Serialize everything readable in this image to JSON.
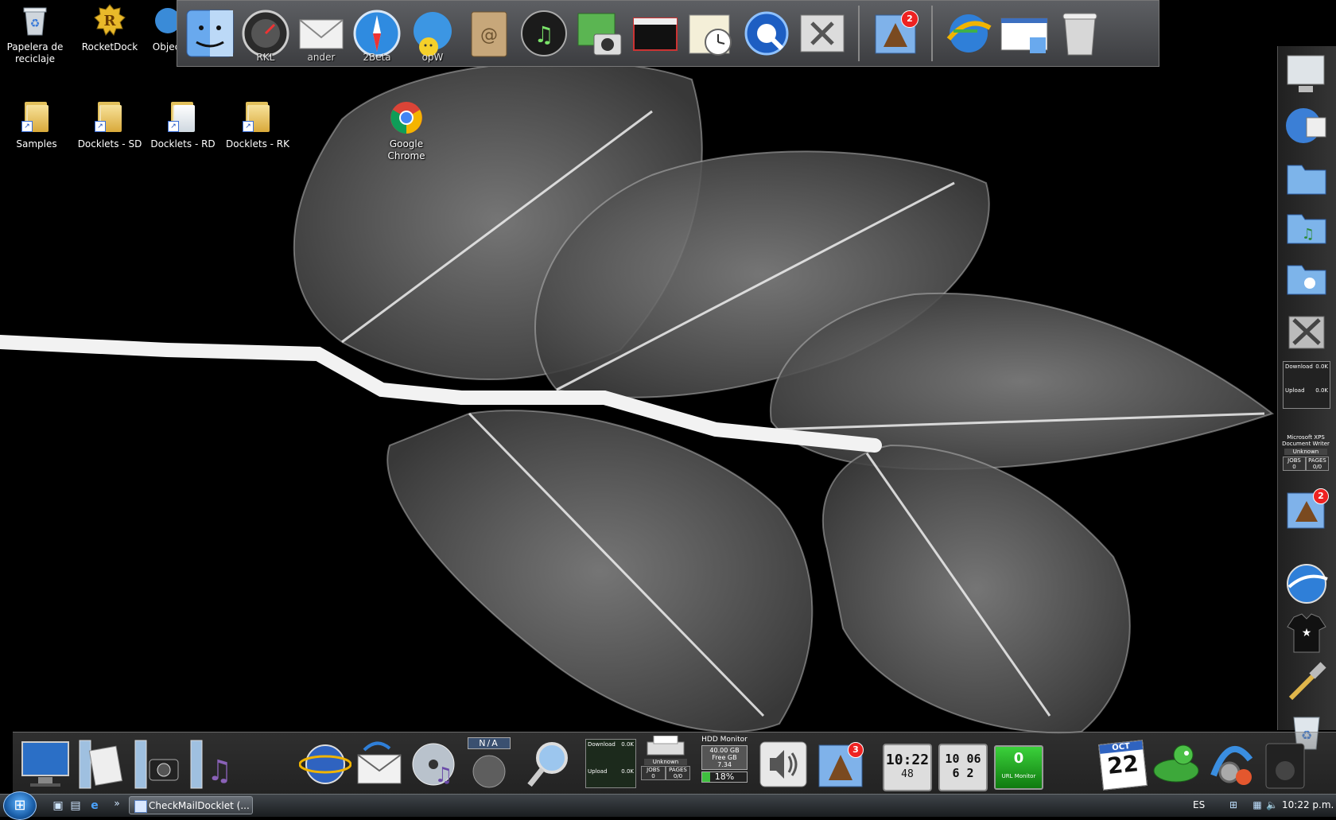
{
  "desktop": {
    "icons": [
      {
        "label": "Papelera de\nreciclaje"
      },
      {
        "label": "RocketDock"
      },
      {
        "label": "Objec"
      },
      {
        "label": "Samples"
      },
      {
        "label": "Docklets - SD"
      },
      {
        "label": "Docklets - RD"
      },
      {
        "label": "Docklets - RK"
      },
      {
        "label": "Google Chrome"
      }
    ]
  },
  "top_dock": {
    "items": [
      {
        "icon": "finder-icon",
        "label": ""
      },
      {
        "icon": "dashboard-icon",
        "label": "RKL"
      },
      {
        "icon": "mail-icon",
        "label": "ander"
      },
      {
        "icon": "safari-icon",
        "label": "2Beta"
      },
      {
        "icon": "messenger-icon",
        "label": "opW"
      },
      {
        "icon": "address-book-icon",
        "label": ""
      },
      {
        "icon": "itunes-icon",
        "label": ""
      },
      {
        "icon": "iphoto-icon",
        "label": ""
      },
      {
        "icon": "movie-icon",
        "label": ""
      },
      {
        "icon": "ical-icon",
        "label": ""
      },
      {
        "icon": "quicktime-icon",
        "label": ""
      },
      {
        "icon": "utilities-icon",
        "label": ""
      },
      {
        "icon": "mail-hawk-icon",
        "label": "",
        "badge": "2"
      },
      {
        "icon": "network-globe-icon",
        "label": ""
      },
      {
        "icon": "window-finder-icon",
        "label": ""
      },
      {
        "icon": "trash-icon",
        "label": ""
      }
    ]
  },
  "right_dock": {
    "download": "Download",
    "download_value": "0.0K",
    "upload": "Upload",
    "upload_value": "0.0K",
    "printer_name": "Microsoft XPS Document Writer",
    "printer_status": "Unknown",
    "jobs_label": "JOBS",
    "jobs_value": "0",
    "pages_label": "PAGES",
    "pages_value": "0/0",
    "mail_badge": "2"
  },
  "bottom_dock": {
    "na_label": "N/A",
    "download": "Download",
    "download_value": "0.0K",
    "upload": "Upload",
    "upload_value": "0.0K",
    "printer_status": "Unknown",
    "jobs_label": "JOBS",
    "jobs_value": "0",
    "pages_label": "PAGES",
    "pages_value": "0/0",
    "hdd_title": "HDD Monitor",
    "hdd_size": "40.00 GB",
    "hdd_free_label": "Free GB",
    "hdd_free_value": "7.34",
    "hdd_percent": "18%",
    "mail_badge": "3",
    "clock1_time": "10:22",
    "clock1_date": "48",
    "clock2_top": "10 06",
    "clock2_bottom": "6 2",
    "url_count": "0",
    "url_label": "URL Monitor",
    "calendar_month": "OCT",
    "calendar_day": "22"
  },
  "taskbar": {
    "task_label": "CheckMailDocklet (...",
    "language": "ES",
    "time": "10:22 p.m."
  }
}
